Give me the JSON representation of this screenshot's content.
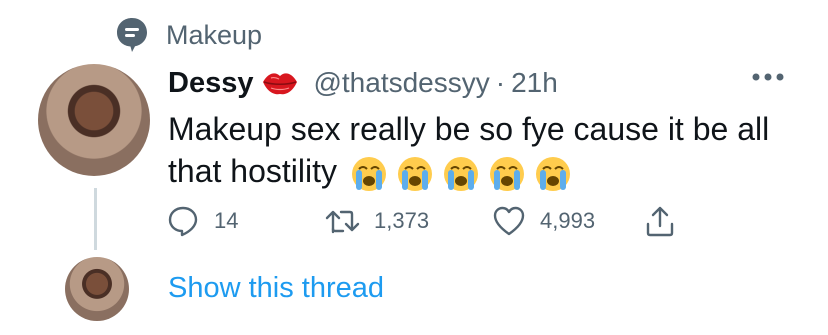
{
  "topic": {
    "icon": "topic-icon",
    "label": "Makeup"
  },
  "tweet": {
    "display_name": "Dessy",
    "name_emoji": "lips-icon",
    "handle": "@thatsdessyy",
    "separator": "·",
    "timestamp": "21h",
    "text": "Makeup sex really be so fye cause it be all that hostility",
    "text_emojis": [
      "loudly-crying-face-icon",
      "loudly-crying-face-icon",
      "loudly-crying-face-icon",
      "loudly-crying-face-icon",
      "loudly-crying-face-icon"
    ],
    "more_icon": "more-icon"
  },
  "actions": {
    "reply": {
      "icon": "reply-icon",
      "count": "14"
    },
    "retweet": {
      "icon": "retweet-icon",
      "count": "1,373"
    },
    "like": {
      "icon": "heart-icon",
      "count": "4,993"
    },
    "share": {
      "icon": "share-icon"
    }
  },
  "thread": {
    "show_label": "Show this thread"
  },
  "colors": {
    "primary_text": "#0f1419",
    "secondary_text": "#536471",
    "accent_link": "#1d9bf0",
    "thread_line": "#cfd9de",
    "icon_gray": "#536471"
  }
}
